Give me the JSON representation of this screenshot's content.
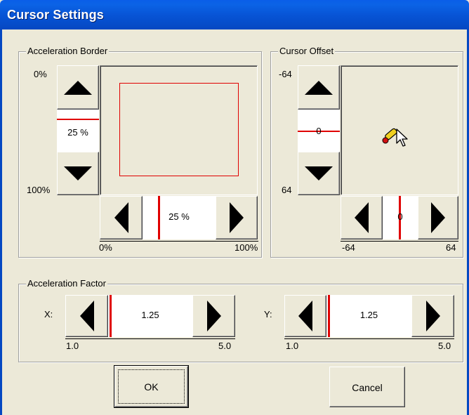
{
  "window": {
    "title": "Cursor Settings"
  },
  "acceleration_border": {
    "label": "Acceleration Border",
    "v_min_label": "0%",
    "v_max_label": "100%",
    "v_value": "25 %",
    "h_value": "25 %",
    "h_min_label": "0%",
    "h_max_label": "100%",
    "border_percent": 25
  },
  "cursor_offset": {
    "label": "Cursor Offset",
    "v_min_label": "-64",
    "v_max_label": "64",
    "v_value": "0",
    "h_value": "0",
    "h_min_label": "-64",
    "h_max_label": "64"
  },
  "acceleration_factor": {
    "label": "Acceleration Factor",
    "x_label": "X:",
    "x_value": "1.25",
    "x_min_label": "1.0",
    "x_max_label": "5.0",
    "y_label": "Y:",
    "y_value": "1.25",
    "y_min_label": "1.0",
    "y_max_label": "5.0"
  },
  "buttons": {
    "ok_label": "OK",
    "cancel_label": "Cancel"
  },
  "colors": {
    "title_bar": "#0553d4",
    "indicator_red": "#e00000",
    "dialog_bg": "#ece9d8"
  },
  "icons": {
    "cursor_preview": "pen-arrow-cursor-icon"
  }
}
